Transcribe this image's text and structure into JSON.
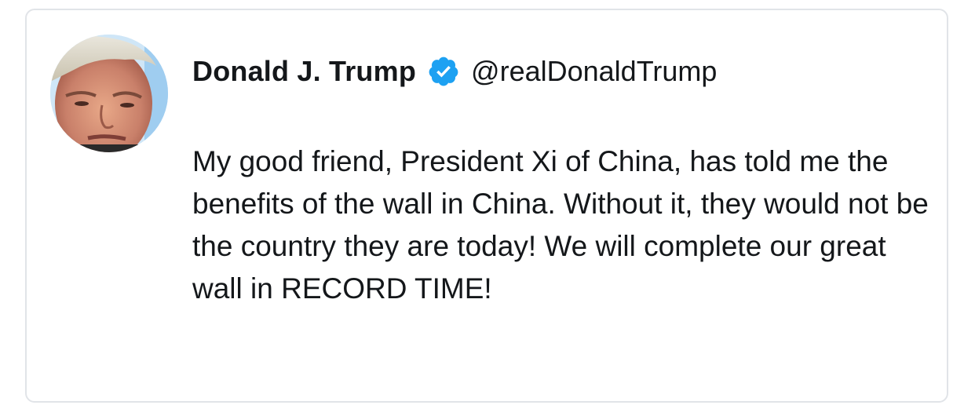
{
  "tweet": {
    "author_name": "Donald J. Trump",
    "handle": "@realDonaldTrump",
    "verified": true,
    "verified_color": "#1da1f2",
    "avatar_icon": "profile-photo",
    "text": "My good friend, President Xi of China, has told me the benefits of the wall in China. Without it, they would not be the country they are today! We will complete our great wall in RECORD TIME!"
  }
}
